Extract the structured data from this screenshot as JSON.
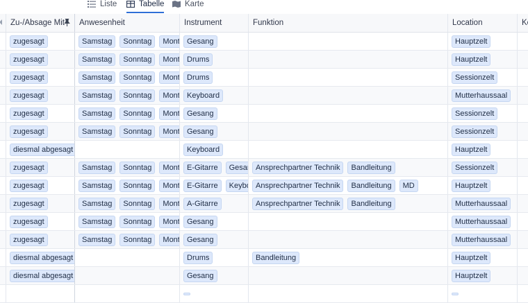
{
  "tabs": [
    {
      "label": "Liste",
      "icon": "list-icon"
    },
    {
      "label": "Tabelle",
      "icon": "table-icon",
      "active": true
    },
    {
      "label": "Karte",
      "icon": "map-icon"
    }
  ],
  "columns": [
    "",
    "Zu-/Absage Mit",
    "Anwesenheit",
    "Instrument",
    "Funktion",
    "Location",
    "Ko"
  ],
  "rows": [
    {
      "status": "zugesagt",
      "days": [
        "Samstag",
        "Sonntag",
        "Montag"
      ],
      "instruments": [
        "Gesang"
      ],
      "functions": [],
      "location": "Hauptzelt"
    },
    {
      "status": "zugesagt",
      "days": [
        "Samstag",
        "Sonntag",
        "Montag"
      ],
      "instruments": [
        "Drums"
      ],
      "functions": [],
      "location": "Hauptzelt"
    },
    {
      "status": "zugesagt",
      "days": [
        "Samstag",
        "Sonntag",
        "Montag"
      ],
      "instruments": [
        "Drums"
      ],
      "functions": [],
      "location": "Sessionzelt"
    },
    {
      "status": "zugesagt",
      "days": [
        "Samstag",
        "Sonntag",
        "Montag"
      ],
      "instruments": [
        "Keyboard"
      ],
      "functions": [],
      "location": "Mutterhaussaal"
    },
    {
      "status": "zugesagt",
      "days": [
        "Samstag",
        "Sonntag",
        "Montag"
      ],
      "instruments": [
        "Gesang"
      ],
      "functions": [],
      "location": "Sessionzelt"
    },
    {
      "status": "zugesagt",
      "days": [
        "Samstag",
        "Sonntag",
        "Montag"
      ],
      "instruments": [
        "Gesang"
      ],
      "functions": [],
      "location": "Sessionzelt"
    },
    {
      "status": "diesmal abgesagt",
      "days": [],
      "instruments": [
        "Keyboard"
      ],
      "functions": [],
      "location": "Hauptzelt"
    },
    {
      "status": "zugesagt",
      "days": [
        "Samstag",
        "Sonntag",
        "Montag"
      ],
      "instruments": [
        "E-Gitarre",
        "Gesang"
      ],
      "functions": [
        "Ansprechpartner Technik",
        "Bandleitung"
      ],
      "location": "Sessionzelt"
    },
    {
      "status": "zugesagt",
      "days": [
        "Samstag",
        "Sonntag",
        "Montag"
      ],
      "instruments": [
        "E-Gitarre",
        "Keyboard"
      ],
      "functions": [
        "Ansprechpartner Technik",
        "Bandleitung",
        "MD"
      ],
      "location": "Hauptzelt"
    },
    {
      "status": "zugesagt",
      "days": [
        "Samstag",
        "Sonntag",
        "Montag"
      ],
      "instruments": [
        "A-Gitarre"
      ],
      "functions": [
        "Ansprechpartner Technik",
        "Bandleitung"
      ],
      "location": "Mutterhaussaal"
    },
    {
      "status": "zugesagt",
      "days": [
        "Samstag",
        "Sonntag",
        "Montag"
      ],
      "instruments": [
        "Gesang"
      ],
      "functions": [],
      "location": "Mutterhaussaal"
    },
    {
      "status": "zugesagt",
      "days": [
        "Samstag",
        "Sonntag",
        "Montag"
      ],
      "instruments": [
        "Gesang"
      ],
      "functions": [],
      "location": "Mutterhaussaal"
    },
    {
      "status": "diesmal abgesagt",
      "days": [],
      "instruments": [
        "Drums"
      ],
      "functions": [
        "Bandleitung"
      ],
      "location": "Hauptzelt"
    },
    {
      "status": "diesmal abgesagt",
      "days": [],
      "instruments": [
        "Gesang"
      ],
      "functions": [],
      "location": "Hauptzelt"
    },
    {
      "status": "",
      "days": [],
      "instruments": [
        ""
      ],
      "functions": [],
      "location": ""
    }
  ],
  "colors": {
    "tag_bg": "#dde8fb",
    "tag_border": "#c5d6f1",
    "accent": "#2f6fd6"
  }
}
